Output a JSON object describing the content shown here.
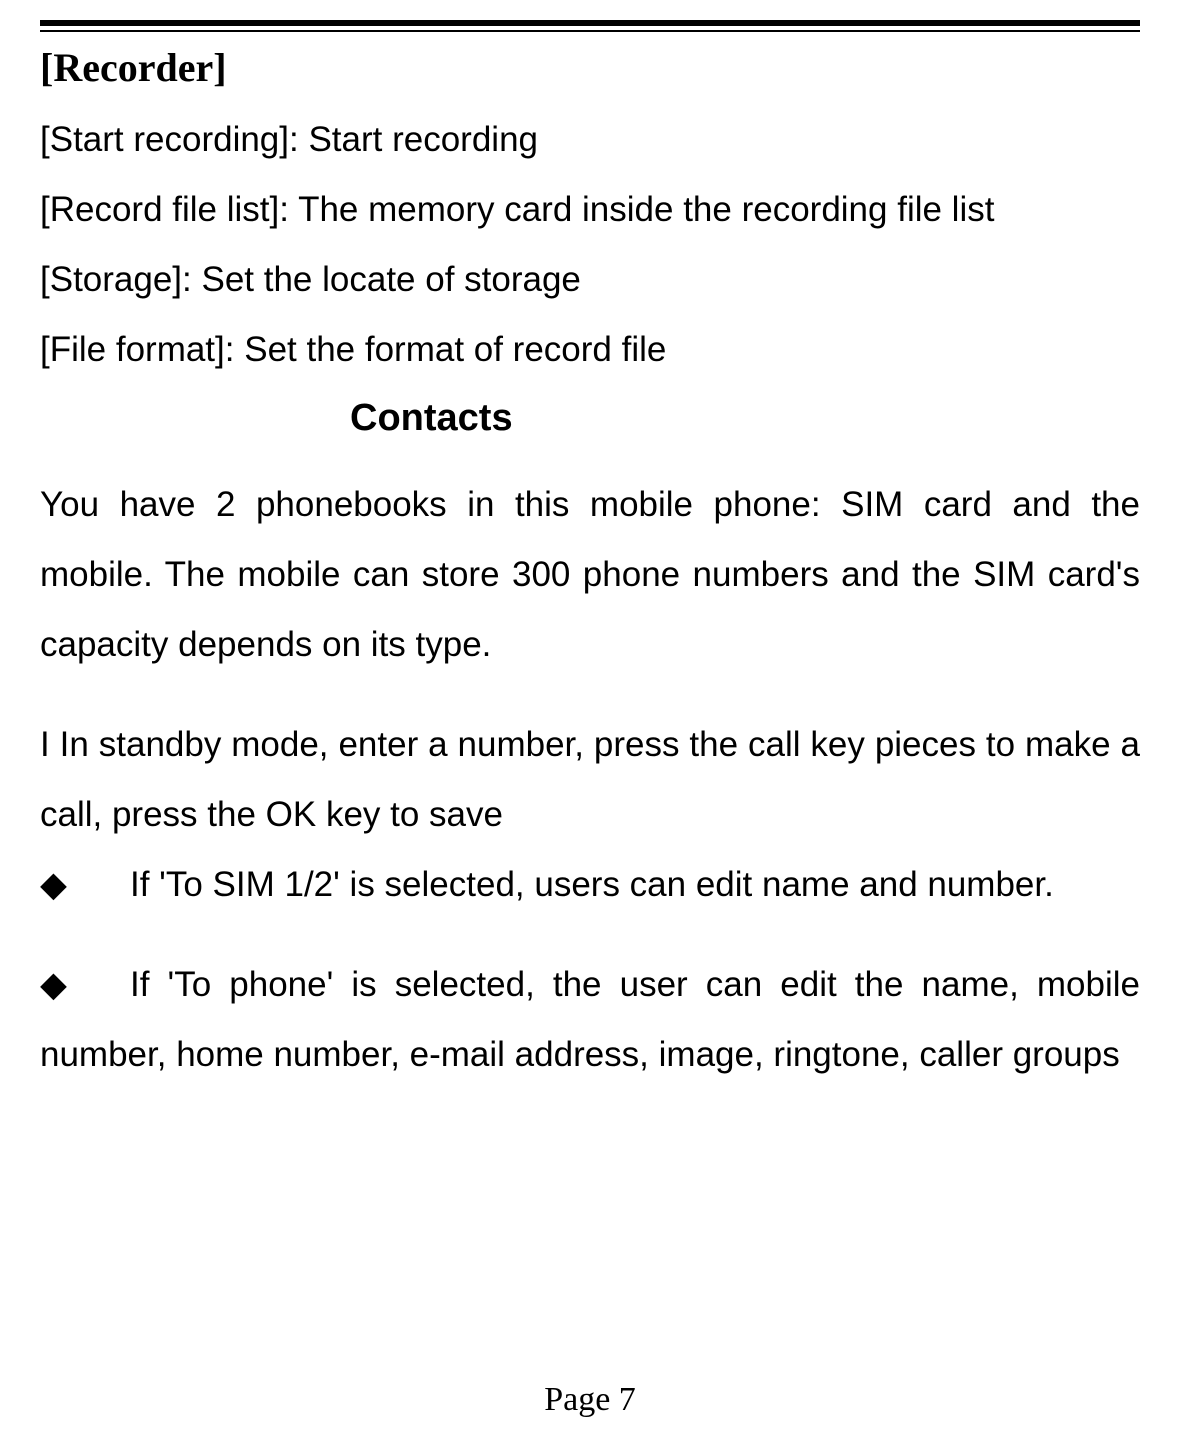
{
  "recorder": {
    "heading": "[Recorder]",
    "items": [
      {
        "label": "[Start recording]: ",
        "desc": "Start recording"
      },
      {
        "label": "[Record file list]: ",
        "desc": "The memory card inside the recording file list"
      },
      {
        "label": "[Storage]: ",
        "desc": "Set the locate of storage"
      },
      {
        "label": "[File format]: ",
        "desc": "Set the format of record file"
      }
    ]
  },
  "contacts": {
    "heading": "Contacts",
    "intro": "You have 2 phonebooks in this mobile phone: SIM card and the mobile. The mobile can store 300 phone numbers and the SIM card's capacity depends on its type.",
    "lead": "I In standby mode, enter a number, press the call key pieces to make a call, press the OK key to save",
    "bullets": [
      "If 'To SIM 1/2' is selected, users can edit name and number.",
      "If 'To phone' is selected, the user can edit the name, mobile number, home number, e-mail address, image, ringtone, caller groups"
    ],
    "bullet_glyph": "◆"
  },
  "footer": {
    "page_label": "Page 7"
  }
}
